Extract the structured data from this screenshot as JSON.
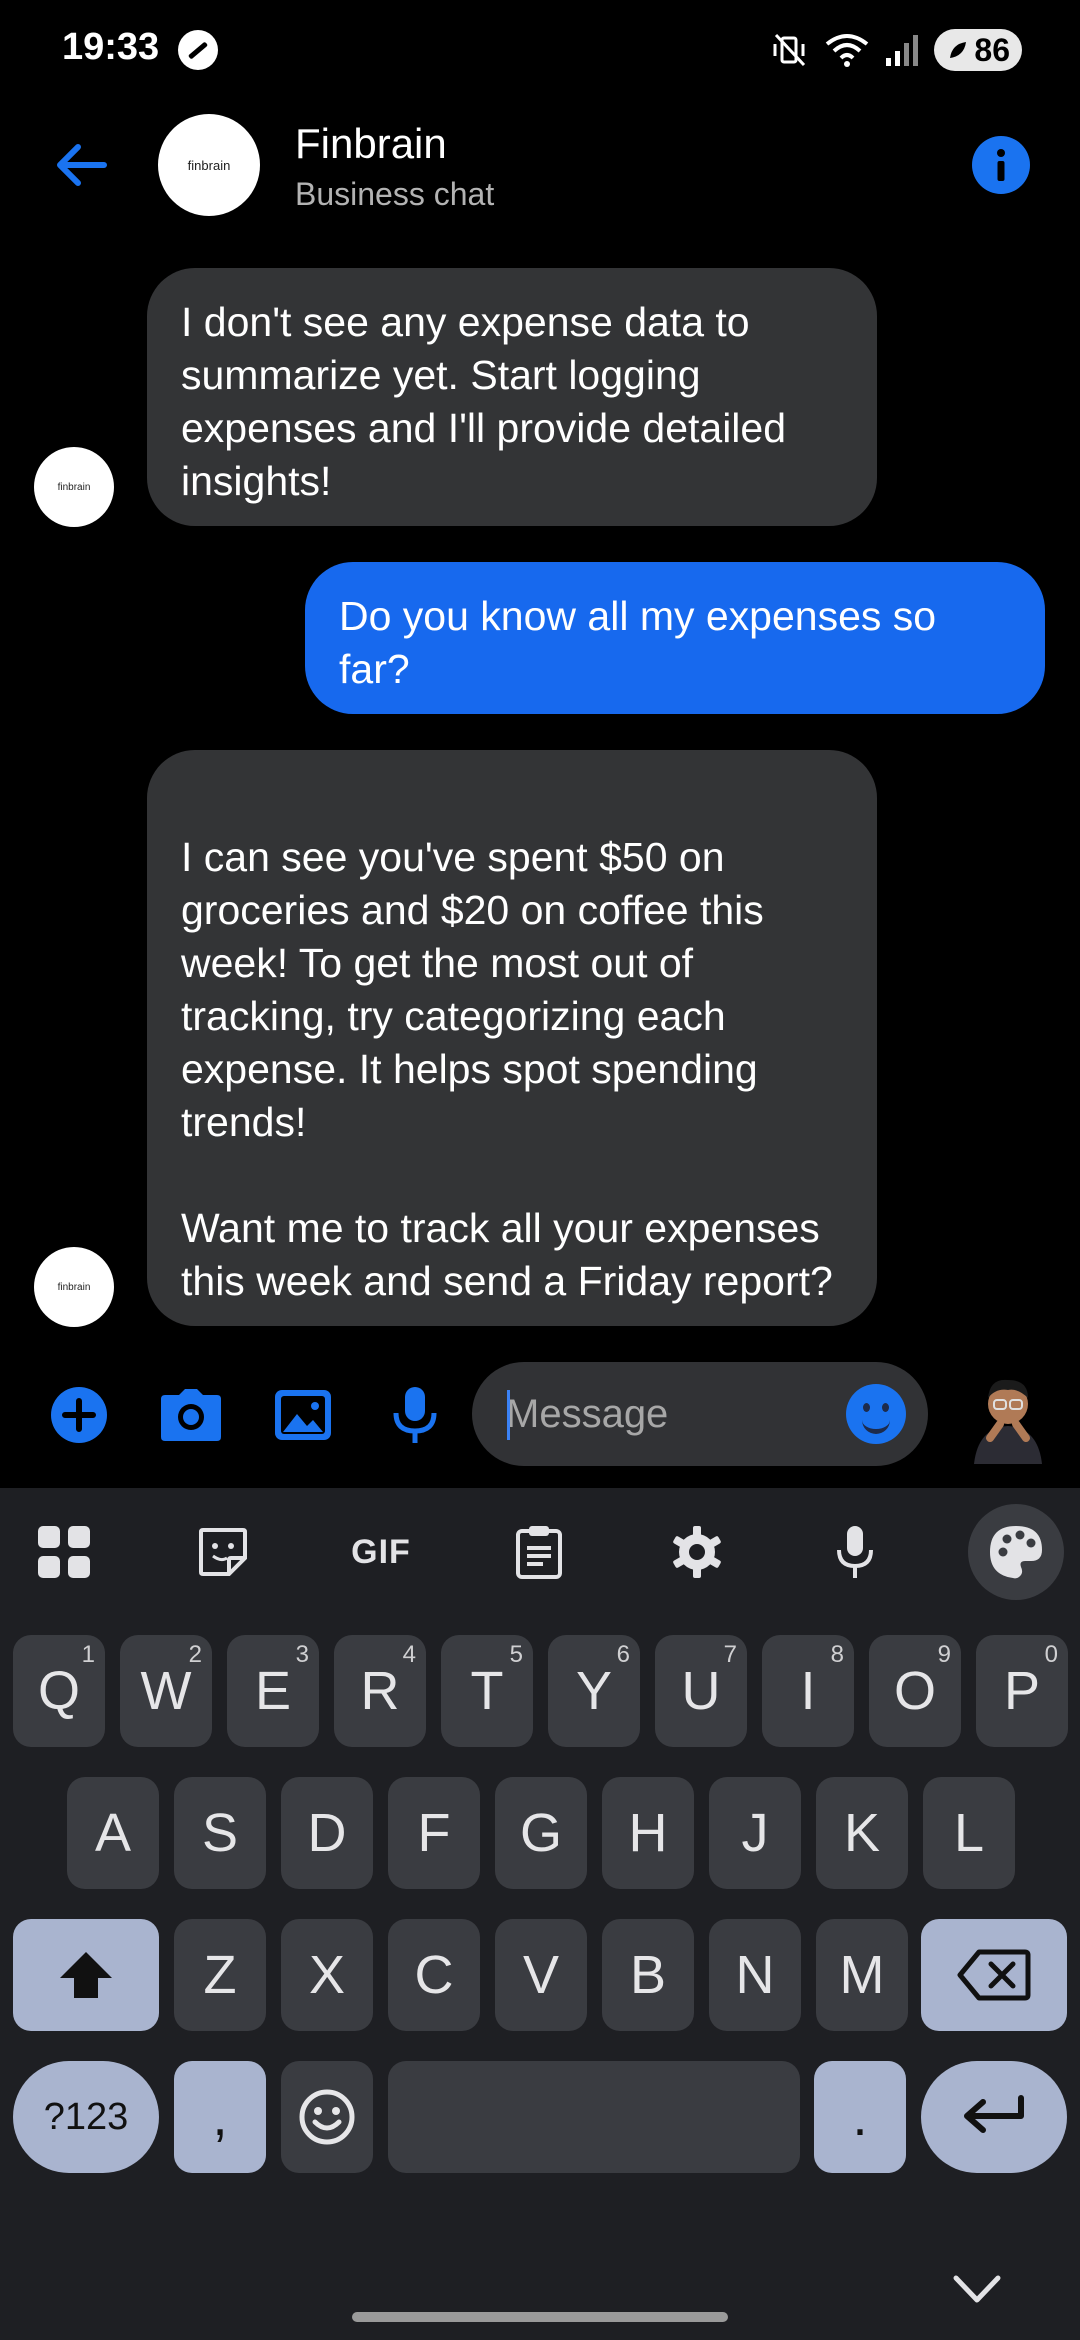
{
  "status_bar": {
    "time": "19:33",
    "battery": "86",
    "icons": [
      "app-notification-icon",
      "mute-vibrate-icon",
      "wifi-icon",
      "signal-icon",
      "battery-saver-icon"
    ]
  },
  "header": {
    "title": "Finbrain",
    "subtitle": "Business chat",
    "avatar_text": "finbrain"
  },
  "messages": [
    {
      "direction": "incoming",
      "text": "I don't see any expense data to summarize yet. Start logging expenses and I'll provide detailed insights!",
      "avatar_text": "finbrain"
    },
    {
      "direction": "outgoing",
      "text": "Do you know all my expenses so far?"
    },
    {
      "direction": "incoming",
      "text": "I can see you've spent $50 on groceries and $20 on coffee this week! To get the most out of tracking, try categorizing each expense. It helps spot spending trends!\n\nWant me to track all your expenses this week and send a Friday report?",
      "avatar_text": "finbrain"
    }
  ],
  "composer": {
    "placeholder": "Message",
    "icons": [
      "plus-icon",
      "camera-icon",
      "gallery-icon",
      "microphone-icon",
      "emoji-icon"
    ]
  },
  "keyboard": {
    "toolbar": [
      "apps-grid-icon",
      "sticker-icon",
      "GIF",
      "clipboard-icon",
      "settings-gear-icon",
      "voice-input-icon",
      "palette-icon"
    ],
    "gif_label": "GIF",
    "row1": [
      {
        "k": "Q",
        "h": "1"
      },
      {
        "k": "W",
        "h": "2"
      },
      {
        "k": "E",
        "h": "3"
      },
      {
        "k": "R",
        "h": "4"
      },
      {
        "k": "T",
        "h": "5"
      },
      {
        "k": "Y",
        "h": "6"
      },
      {
        "k": "U",
        "h": "7"
      },
      {
        "k": "I",
        "h": "8"
      },
      {
        "k": "O",
        "h": "9"
      },
      {
        "k": "P",
        "h": "0"
      }
    ],
    "row2": [
      "A",
      "S",
      "D",
      "F",
      "G",
      "H",
      "J",
      "K",
      "L"
    ],
    "row3": [
      "Z",
      "X",
      "C",
      "V",
      "B",
      "N",
      "M"
    ],
    "symbols_label": "?123",
    "comma": ",",
    "period": "."
  },
  "colors": {
    "accent": "#1a73f0",
    "outgoing_bubble": "#1769ee",
    "incoming_bubble": "#333436",
    "keyboard_bg": "#1e1f23",
    "key_bg": "#3a3c41",
    "special_key_bg": "#a9b4cf"
  }
}
